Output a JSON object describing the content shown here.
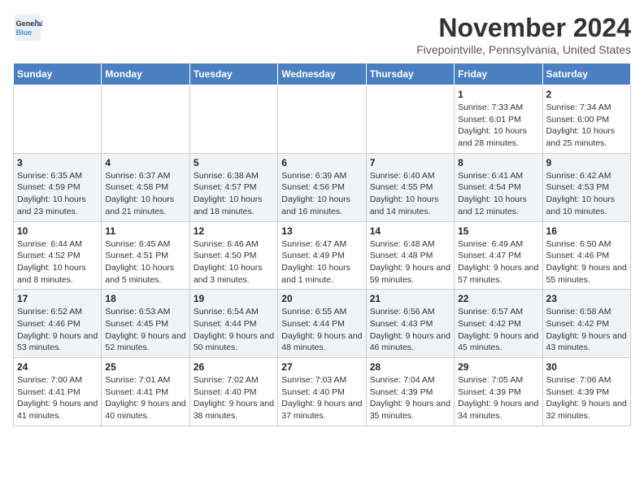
{
  "logo": {
    "line1": "General",
    "line2": "Blue"
  },
  "title": "November 2024",
  "location": "Fivepointville, Pennsylvania, United States",
  "days_of_week": [
    "Sunday",
    "Monday",
    "Tuesday",
    "Wednesday",
    "Thursday",
    "Friday",
    "Saturday"
  ],
  "weeks": [
    [
      {
        "day": "",
        "info": ""
      },
      {
        "day": "",
        "info": ""
      },
      {
        "day": "",
        "info": ""
      },
      {
        "day": "",
        "info": ""
      },
      {
        "day": "",
        "info": ""
      },
      {
        "day": "1",
        "info": "Sunrise: 7:33 AM\nSunset: 6:01 PM\nDaylight: 10 hours and 28 minutes."
      },
      {
        "day": "2",
        "info": "Sunrise: 7:34 AM\nSunset: 6:00 PM\nDaylight: 10 hours and 25 minutes."
      }
    ],
    [
      {
        "day": "3",
        "info": "Sunrise: 6:35 AM\nSunset: 4:59 PM\nDaylight: 10 hours and 23 minutes."
      },
      {
        "day": "4",
        "info": "Sunrise: 6:37 AM\nSunset: 4:58 PM\nDaylight: 10 hours and 21 minutes."
      },
      {
        "day": "5",
        "info": "Sunrise: 6:38 AM\nSunset: 4:57 PM\nDaylight: 10 hours and 18 minutes."
      },
      {
        "day": "6",
        "info": "Sunrise: 6:39 AM\nSunset: 4:56 PM\nDaylight: 10 hours and 16 minutes."
      },
      {
        "day": "7",
        "info": "Sunrise: 6:40 AM\nSunset: 4:55 PM\nDaylight: 10 hours and 14 minutes."
      },
      {
        "day": "8",
        "info": "Sunrise: 6:41 AM\nSunset: 4:54 PM\nDaylight: 10 hours and 12 minutes."
      },
      {
        "day": "9",
        "info": "Sunrise: 6:42 AM\nSunset: 4:53 PM\nDaylight: 10 hours and 10 minutes."
      }
    ],
    [
      {
        "day": "10",
        "info": "Sunrise: 6:44 AM\nSunset: 4:52 PM\nDaylight: 10 hours and 8 minutes."
      },
      {
        "day": "11",
        "info": "Sunrise: 6:45 AM\nSunset: 4:51 PM\nDaylight: 10 hours and 5 minutes."
      },
      {
        "day": "12",
        "info": "Sunrise: 6:46 AM\nSunset: 4:50 PM\nDaylight: 10 hours and 3 minutes."
      },
      {
        "day": "13",
        "info": "Sunrise: 6:47 AM\nSunset: 4:49 PM\nDaylight: 10 hours and 1 minute."
      },
      {
        "day": "14",
        "info": "Sunrise: 6:48 AM\nSunset: 4:48 PM\nDaylight: 9 hours and 59 minutes."
      },
      {
        "day": "15",
        "info": "Sunrise: 6:49 AM\nSunset: 4:47 PM\nDaylight: 9 hours and 57 minutes."
      },
      {
        "day": "16",
        "info": "Sunrise: 6:50 AM\nSunset: 4:46 PM\nDaylight: 9 hours and 55 minutes."
      }
    ],
    [
      {
        "day": "17",
        "info": "Sunrise: 6:52 AM\nSunset: 4:46 PM\nDaylight: 9 hours and 53 minutes."
      },
      {
        "day": "18",
        "info": "Sunrise: 6:53 AM\nSunset: 4:45 PM\nDaylight: 9 hours and 52 minutes."
      },
      {
        "day": "19",
        "info": "Sunrise: 6:54 AM\nSunset: 4:44 PM\nDaylight: 9 hours and 50 minutes."
      },
      {
        "day": "20",
        "info": "Sunrise: 6:55 AM\nSunset: 4:44 PM\nDaylight: 9 hours and 48 minutes."
      },
      {
        "day": "21",
        "info": "Sunrise: 6:56 AM\nSunset: 4:43 PM\nDaylight: 9 hours and 46 minutes."
      },
      {
        "day": "22",
        "info": "Sunrise: 6:57 AM\nSunset: 4:42 PM\nDaylight: 9 hours and 45 minutes."
      },
      {
        "day": "23",
        "info": "Sunrise: 6:58 AM\nSunset: 4:42 PM\nDaylight: 9 hours and 43 minutes."
      }
    ],
    [
      {
        "day": "24",
        "info": "Sunrise: 7:00 AM\nSunset: 4:41 PM\nDaylight: 9 hours and 41 minutes."
      },
      {
        "day": "25",
        "info": "Sunrise: 7:01 AM\nSunset: 4:41 PM\nDaylight: 9 hours and 40 minutes."
      },
      {
        "day": "26",
        "info": "Sunrise: 7:02 AM\nSunset: 4:40 PM\nDaylight: 9 hours and 38 minutes."
      },
      {
        "day": "27",
        "info": "Sunrise: 7:03 AM\nSunset: 4:40 PM\nDaylight: 9 hours and 37 minutes."
      },
      {
        "day": "28",
        "info": "Sunrise: 7:04 AM\nSunset: 4:39 PM\nDaylight: 9 hours and 35 minutes."
      },
      {
        "day": "29",
        "info": "Sunrise: 7:05 AM\nSunset: 4:39 PM\nDaylight: 9 hours and 34 minutes."
      },
      {
        "day": "30",
        "info": "Sunrise: 7:06 AM\nSunset: 4:39 PM\nDaylight: 9 hours and 32 minutes."
      }
    ]
  ]
}
